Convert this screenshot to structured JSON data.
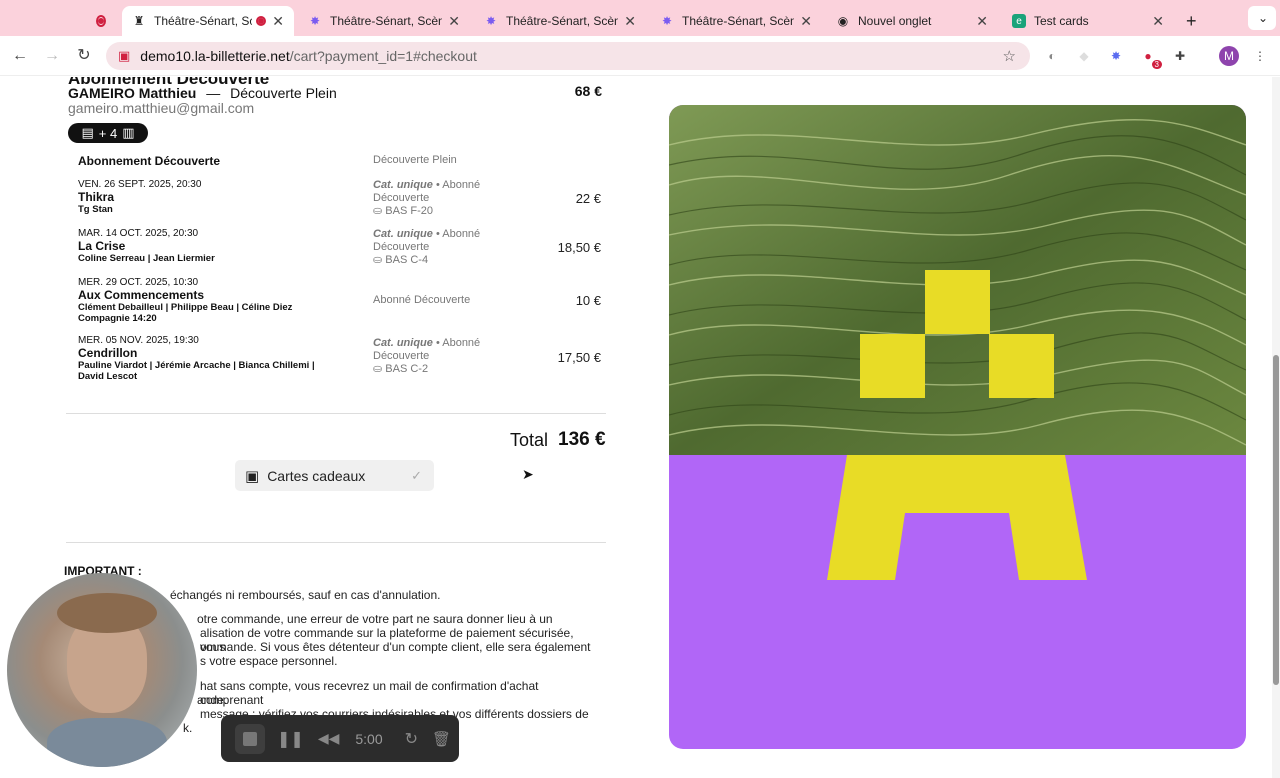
{
  "browser": {
    "tabs": [
      {
        "title": "",
        "kind": "record"
      },
      {
        "title": "Théâtre-Sénart, Sc",
        "kind": "active"
      },
      {
        "title": "Théâtre-Sénart, Scène",
        "kind": "normal"
      },
      {
        "title": "Théâtre-Sénart, Scène",
        "kind": "normal"
      },
      {
        "title": "Théâtre-Sénart, Scène",
        "kind": "normal"
      },
      {
        "title": "Nouvel onglet",
        "kind": "normal"
      },
      {
        "title": "Test cards",
        "kind": "normal"
      }
    ],
    "url_host": "demo10.la-billetterie.net",
    "url_path": "/cart?payment_id=1#checkout",
    "extension_badge": "3",
    "profile_initial": "M"
  },
  "cart": {
    "title": "Abonnement Découverte",
    "holder_name": "GAMEIRO Matthieu",
    "holder_separator": "—",
    "holder_rate": "Découverte Plein",
    "holder_email": "gameiro.matthieu@gmail.com",
    "pill_text": "+ 4",
    "top_price": "68 €",
    "sub_heading": "Abonnement Découverte",
    "sub_category": "Découverte Plein",
    "items": [
      {
        "date": "VEN. 26 SEPT. 2025, 20:30",
        "name": "Thikra",
        "artists": "Tg Stan",
        "cat": "Cat. unique",
        "rate": " • Abonné Découverte",
        "seat": "BAS F-20",
        "price": "22 €"
      },
      {
        "date": "MAR. 14 OCT. 2025, 20:30",
        "name": "La Crise",
        "artists": "Coline Serreau | Jean Liermier",
        "cat": "Cat. unique",
        "rate": " • Abonné Découverte",
        "seat": "BAS C-4",
        "price": "18,50 €"
      },
      {
        "date": "MER. 29 OCT. 2025, 10:30",
        "name": "Aux Commencements",
        "artists": "Clément Debailleul | Philippe Beau | Céline Diez Compagnie 14:20",
        "cat": "",
        "rate": "Abonné Découverte",
        "seat": "",
        "price": "10 €"
      },
      {
        "date": "MER. 05 NOV. 2025, 19:30",
        "name": "Cendrillon",
        "artists": "Pauline Viardot | Jérémie Arcache | Bianca Chillemi | David Lescot",
        "cat": "Cat. unique",
        "rate": " • Abonné Découverte",
        "seat": "BAS C-2",
        "price": "17,50 €"
      }
    ],
    "total_label": "Total",
    "total_value": "136 €",
    "giftcard_label": "Cartes cadeaux"
  },
  "important": {
    "heading": "IMPORTANT :",
    "lines": [
      "échangés ni remboursés, sauf en cas d'annulation.",
      "otre commande, une erreur de votre part ne saura donner lieu à un",
      "alisation de votre commande sur la plateforme de paiement sécurisée, vous",
      "ommande. Si vous êtes détenteur d'un compte client, elle sera également",
      "s votre espace personnel.",
      "hat sans compte, vous recevrez un mail de confirmation d'achat comprenant",
      "ande.",
      "message : vérifiez vos courriers indésirables et vos différents dossiers de",
      "k."
    ]
  },
  "recorder": {
    "time": "5:00"
  },
  "colors": {
    "tabbar": "#fbd2dc",
    "art_purple": "#b166f7",
    "art_yellow": "#e8dc26",
    "grass": "#5f7a3a"
  }
}
